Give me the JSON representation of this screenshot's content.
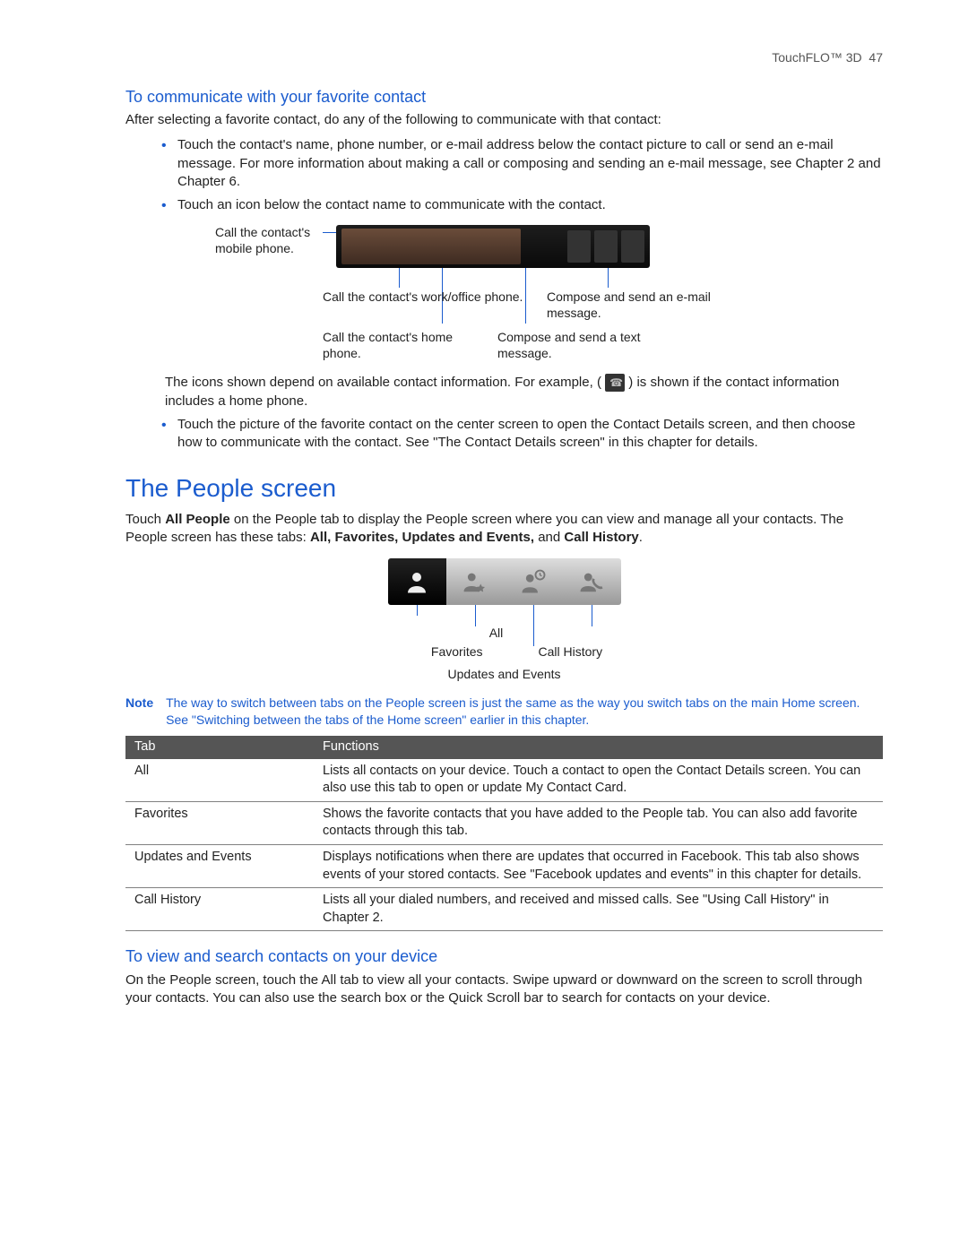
{
  "header": {
    "chapter": "TouchFLO™ 3D",
    "page": "47"
  },
  "section1": {
    "title": "To communicate with your favorite contact",
    "lead": "After selecting a favorite contact, do any of the following to communicate with that contact:",
    "bullets": {
      "b1": "Touch the contact's name, phone number, or e-mail address below the contact picture to call or send an e-mail message. For more information about making a call or composing and sending an e-mail message, see Chapter 2 and Chapter 6.",
      "b2": "Touch an icon below the contact name to communicate with the contact."
    },
    "callouts": {
      "mobile": "Call the contact's mobile phone.",
      "work": "Call the contact's work/office phone.",
      "home": "Call the contact's home phone.",
      "email": "Compose and send an e-mail message.",
      "text": "Compose and send a text message."
    },
    "icons_note_pre": "The icons shown depend on available contact information. For example, (",
    "icons_note_post": ") is shown if the contact information includes a home phone.",
    "b3": "Touch the picture of the favorite contact on the center screen to open the Contact Details screen, and then choose how to communicate with the contact. See \"The Contact Details screen\" in this chapter for details."
  },
  "section2": {
    "title": "The People screen",
    "lead_pre": "Touch ",
    "lead_bold": "All People",
    "lead_mid": " on the People tab to display the People screen where you can view and manage all your contacts. The People screen has these tabs: ",
    "tabs_bold": "All, Favorites, Updates and Events,",
    "lead_and": " and ",
    "tabs_bold2": "Call History",
    "lead_end": ".",
    "tab_labels": {
      "all": "All",
      "fav": "Favorites",
      "call": "Call History",
      "upd": "Updates and Events"
    },
    "note_label": "Note",
    "note_text": "The way to switch between tabs on the People screen is just the same as the way you switch tabs on the main Home screen. See \"Switching between the tabs of the Home screen\" earlier in this chapter.",
    "table": {
      "th1": "Tab",
      "th2": "Functions",
      "rows": [
        {
          "tab": "All",
          "fn": "Lists all contacts on your device. Touch a contact to open the Contact Details screen. You can also use this tab to open or update My Contact Card."
        },
        {
          "tab": "Favorites",
          "fn": "Shows the favorite contacts that you have added to the People tab. You can also add favorite contacts through this tab."
        },
        {
          "tab": "Updates and Events",
          "fn": "Displays notifications when there are updates that occurred in Facebook. This tab also shows events of your stored contacts. See \"Facebook updates and events\" in this chapter for details."
        },
        {
          "tab": "Call History",
          "fn": "Lists all your dialed numbers, and received and missed calls. See \"Using Call History\" in Chapter 2."
        }
      ]
    }
  },
  "section3": {
    "title": "To view and search contacts on your device",
    "body": "On the People screen, touch the All tab to view all your contacts. Swipe upward or downward on the screen to scroll through your contacts. You can also use the search box or the Quick Scroll bar to search for contacts on your device."
  }
}
